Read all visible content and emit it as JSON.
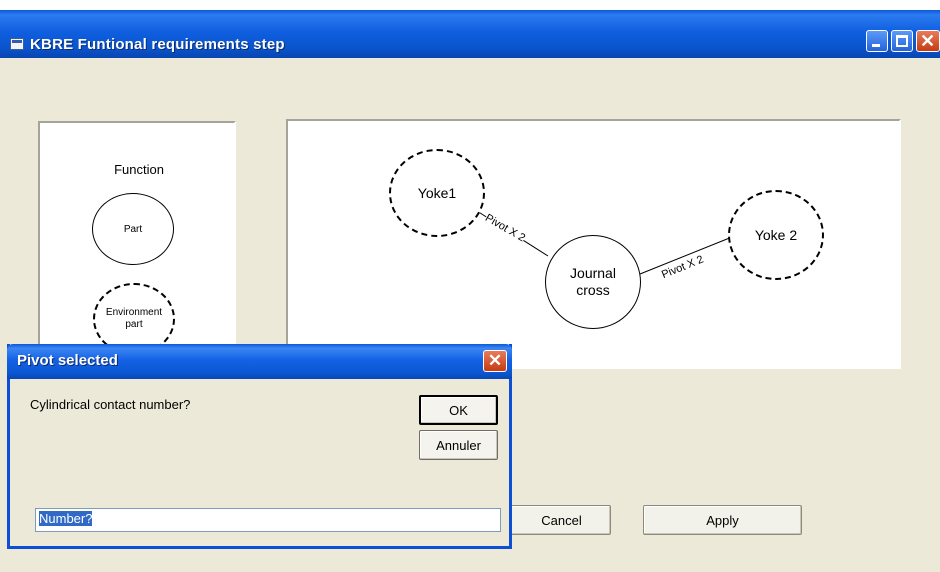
{
  "window": {
    "title": "KBRE Funtional requirements step"
  },
  "legend": {
    "function_label": "Function",
    "part_label": "Part",
    "environment_part_label_line1": "Environment",
    "environment_part_label_line2": "part"
  },
  "diagram": {
    "nodes": {
      "yoke1": "Yoke1",
      "yoke2": "Yoke 2",
      "journal_line1": "Journal",
      "journal_line2": "cross"
    },
    "edges": {
      "left": "Pivot X 2",
      "right": "Pivot X 2"
    }
  },
  "buttons": {
    "cancel": "Cancel",
    "apply": "Apply"
  },
  "dialog": {
    "title": "Pivot selected",
    "prompt": "Cylindrical contact number?",
    "ok": "OK",
    "annuler": "Annuler",
    "input_value": "Number?"
  },
  "colors": {
    "xp_title_blue": "#0a54cc",
    "xp_close_red": "#c63b12",
    "face": "#ece9d8",
    "selection": "#316ac5"
  }
}
